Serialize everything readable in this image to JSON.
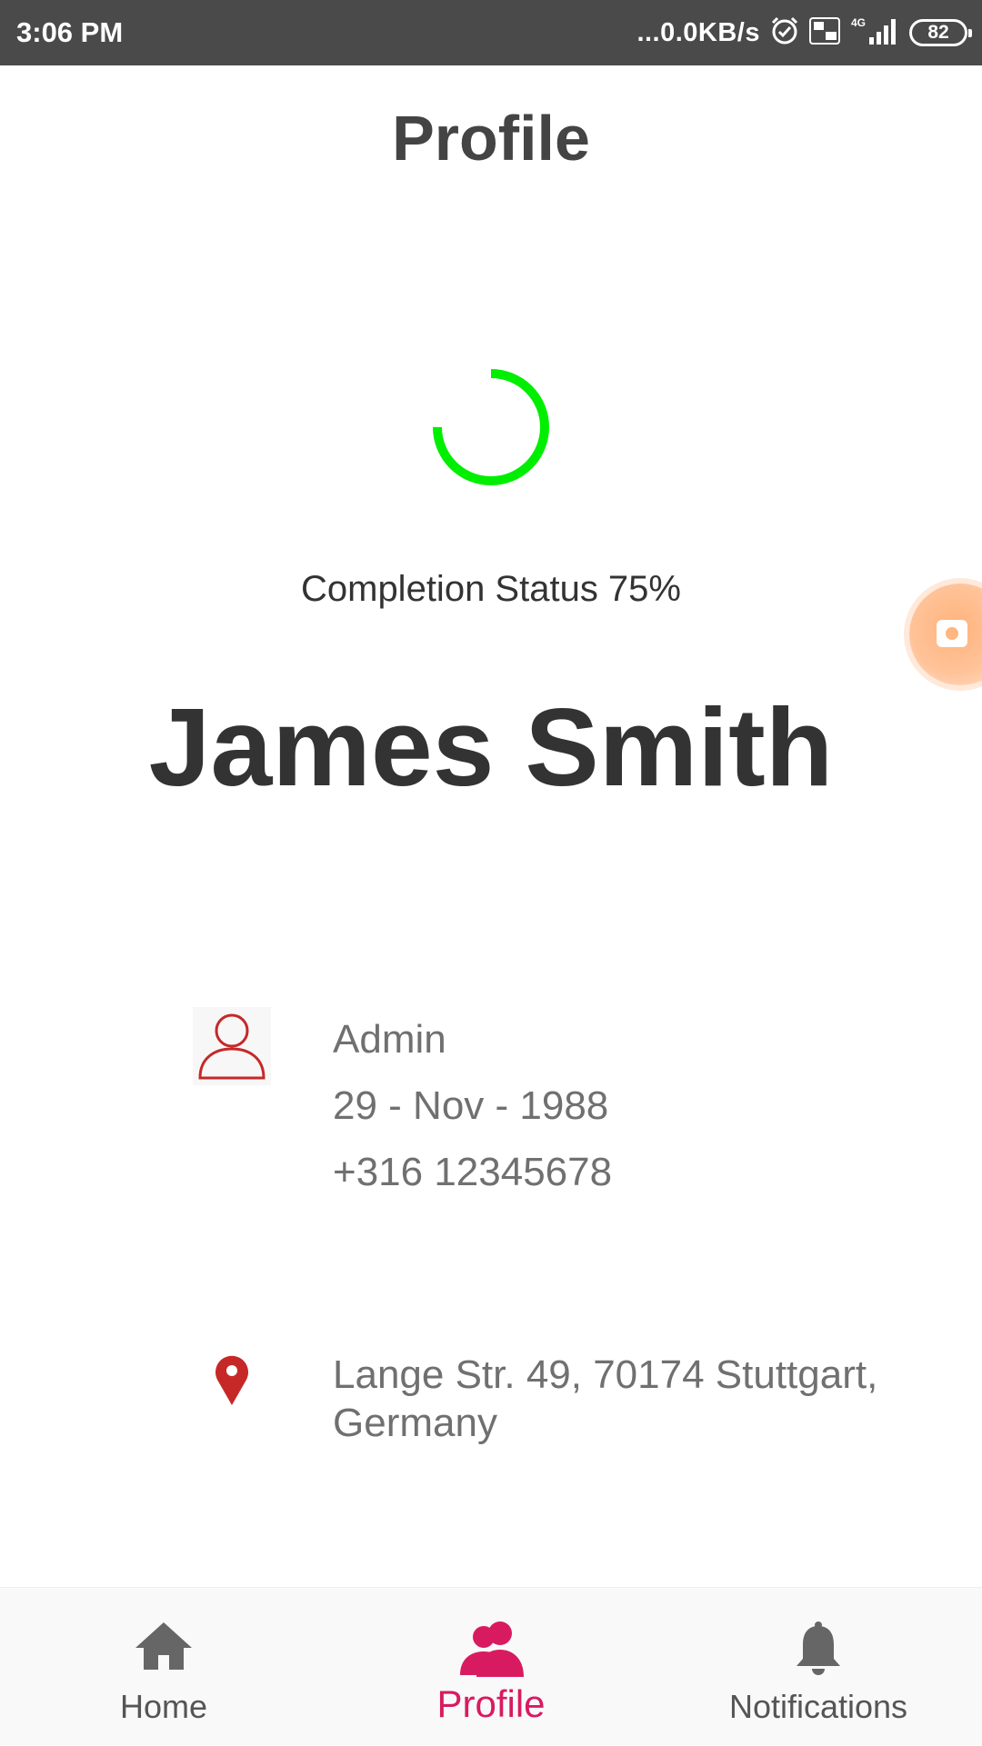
{
  "status_bar": {
    "time": "3:06 PM",
    "network_speed": "...0.0KB/s",
    "battery": "82",
    "icons": [
      "alarm-icon",
      "volte-icon",
      "signal-4g-icon",
      "battery-icon"
    ]
  },
  "header": {
    "title": "Profile"
  },
  "progress": {
    "value": 0.75,
    "label": "Completion Status 75%",
    "color": "#00ee00"
  },
  "profile": {
    "name": "James Smith",
    "role": "Admin",
    "birthdate": "29 - Nov - 1988",
    "phone": "+316 12345678",
    "address": "Lange Str. 49, 70174 Stuttgart, Germany"
  },
  "nav": {
    "items": [
      {
        "label": "Home",
        "icon": "home-icon",
        "active": false
      },
      {
        "label": "Profile",
        "icon": "profile-icon",
        "active": true
      },
      {
        "label": "Notifications",
        "icon": "bell-icon",
        "active": false
      }
    ]
  },
  "colors": {
    "accent": "#d81b60",
    "icon_red": "#c62828",
    "progress": "#00ee00",
    "status_bar": "#4a4a4a"
  }
}
